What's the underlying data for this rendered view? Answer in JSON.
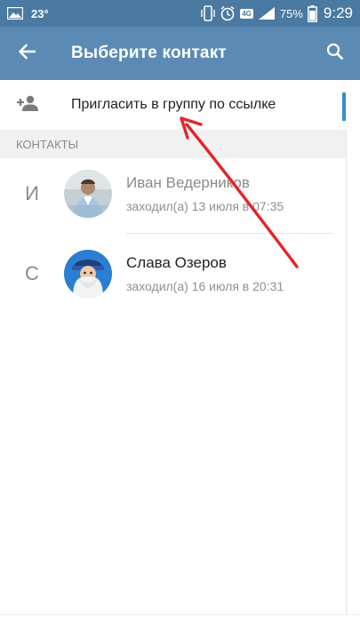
{
  "status_bar": {
    "temperature": "23°",
    "network_badge": "4G",
    "battery_percent": "75%",
    "time": "9:29"
  },
  "app_bar": {
    "title": "Выберите контакт",
    "back_icon": "arrow-left-icon",
    "search_icon": "search-icon"
  },
  "invite": {
    "label": "Пригласить в группу по ссылке",
    "icon": "add-person-icon"
  },
  "section": {
    "title": "КОНТАКТЫ"
  },
  "contacts": [
    {
      "letter": "И",
      "name": "Иван Ведерников",
      "status": "заходил(а) 13 июля в 07:35"
    },
    {
      "letter": "С",
      "name": "Слава Озеров",
      "status": "заходил(а) 16 июля в 20:31"
    }
  ],
  "colors": {
    "status_bar": "#4a79a1",
    "app_bar": "#5b8bb4",
    "scroll_indicator": "#2f8fd0",
    "annotation_arrow": "#e0262a"
  }
}
